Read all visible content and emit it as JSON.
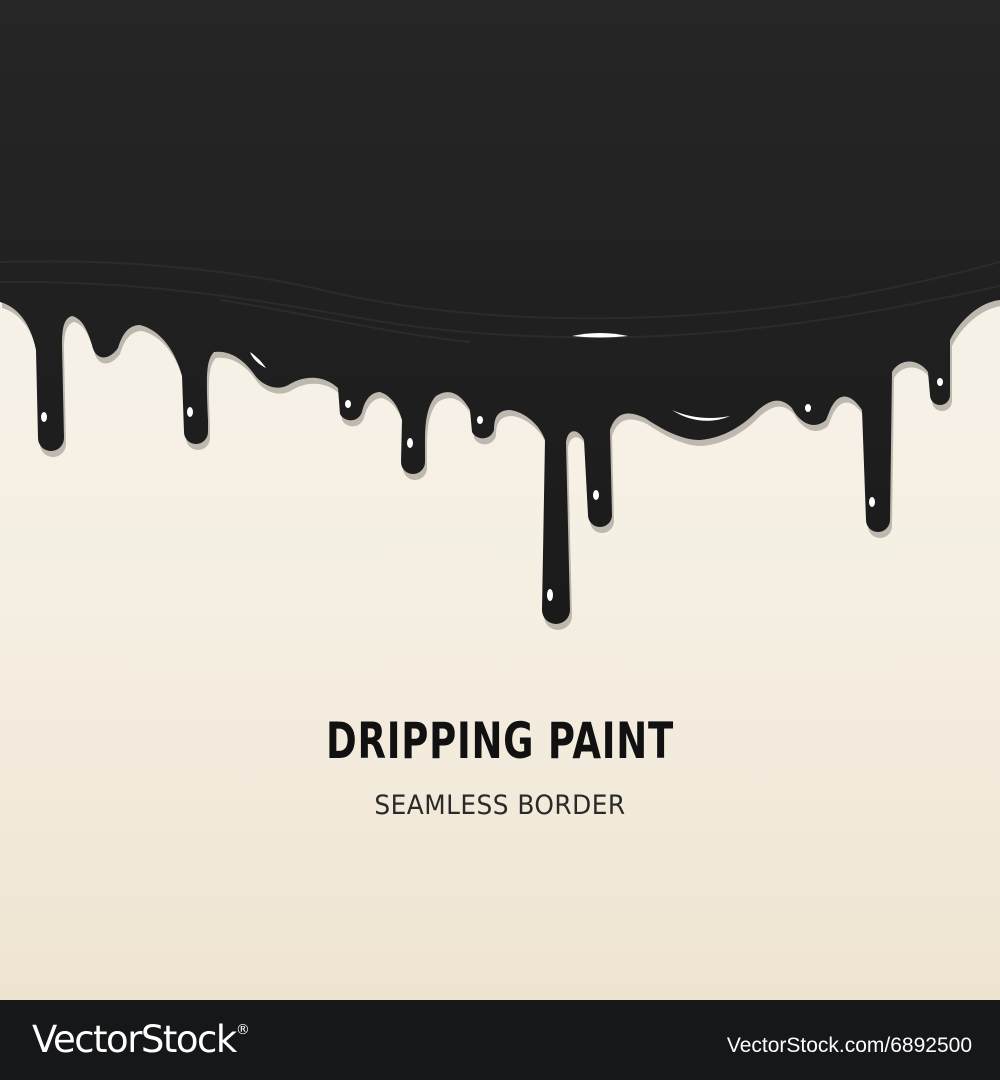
{
  "artwork": {
    "title": "DRIPPING PAINT",
    "subtitle": "SEAMLESS BORDER",
    "colors": {
      "paint": "#1f1f1f",
      "highlight": "#ffffff",
      "background_top": "#f8f4ec",
      "background_bottom": "#efe4d1"
    }
  },
  "footer": {
    "brand": "VectorStock",
    "brand_mark": "®",
    "image_id": "VectorStock.com/6892500",
    "colors": {
      "bar": "#161719",
      "text": "#ffffff"
    }
  }
}
